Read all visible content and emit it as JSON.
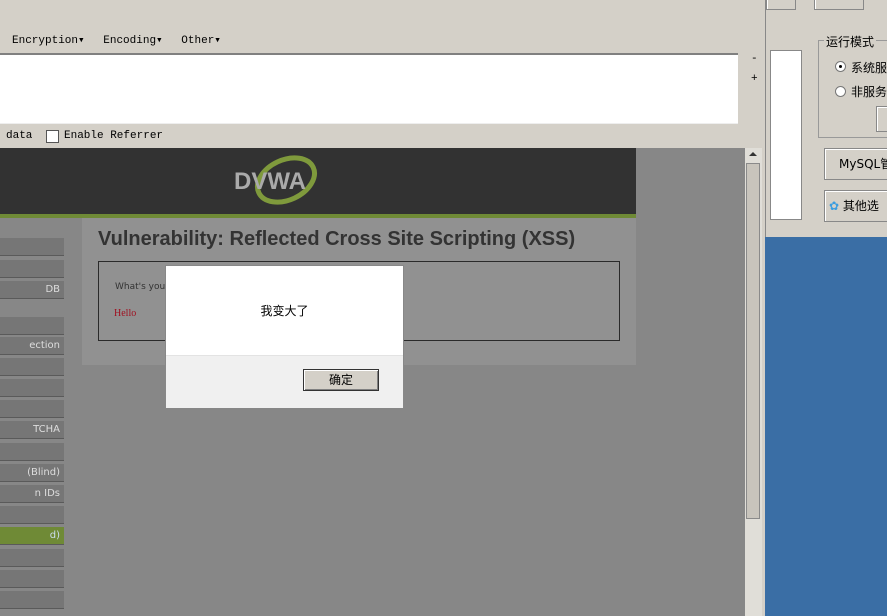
{
  "toolbar": {
    "menus": [
      "Encryption▾",
      "Encoding▾",
      "Other▾"
    ],
    "minus": "-",
    "plus": "+",
    "data_label": "data",
    "enable_referrer": "Enable Referrer",
    "enable_referrer_checked": false
  },
  "dvwa": {
    "logo": "DVWA",
    "title": "Vulnerability: Reflected Cross Site Scripting (XSS)",
    "prompt": "What's you",
    "output": "Hello",
    "sidebar": [
      "",
      "",
      "DB",
      "",
      "ection",
      "",
      "",
      "",
      "TCHA",
      "",
      "(Blind)",
      "n IDs",
      "",
      "d)",
      "",
      "",
      ""
    ],
    "active_index": 13
  },
  "alert": {
    "message": "我变大了",
    "ok": "确定"
  },
  "side_panel": {
    "group_title": "运行模式",
    "radio1": "系统服",
    "radio2": "非服务",
    "radio1_checked": true,
    "mysql_button": "MySQL管",
    "other_button": "其他选"
  },
  "colors": {
    "dvwa_green": "#6f8a36",
    "desktop_blue": "#3a6ea5"
  }
}
